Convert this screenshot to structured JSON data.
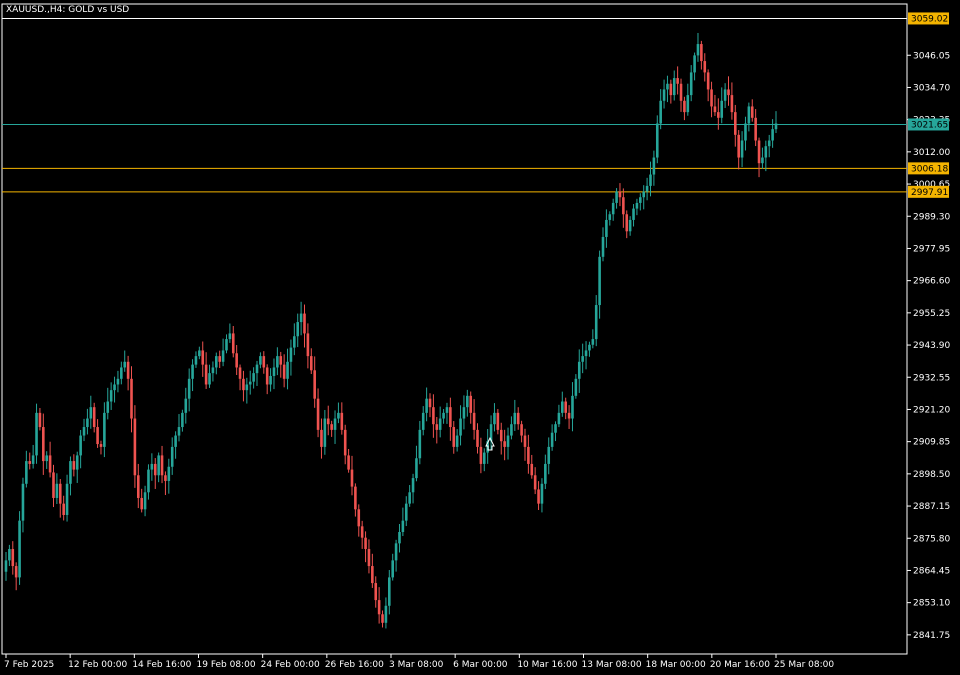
{
  "title": "XAUUSD.,H4:  GOLD vs USD",
  "colors": {
    "background": "#000000",
    "bull": "#26a69a",
    "bear": "#ef5350",
    "axis": "#ffffff",
    "bid_line": "#26a69a",
    "level_line": "#f4b400",
    "top_line": "#ffffff"
  },
  "price_axis": {
    "ticks": [
      "3046.05",
      "3034.70",
      "3023.35",
      "3012.00",
      "3000.65",
      "2989.30",
      "2977.95",
      "2966.60",
      "2955.25",
      "2943.90",
      "2932.55",
      "2921.20",
      "2909.85",
      "2898.50",
      "2887.15",
      "2875.80",
      "2864.45",
      "2853.10",
      "2841.75"
    ]
  },
  "time_axis": {
    "labels": [
      "7 Feb 2025",
      "12 Feb 00:00",
      "14 Feb 16:00",
      "19 Feb 08:00",
      "24 Feb 00:00",
      "26 Feb 16:00",
      "3 Mar 08:00",
      "6 Mar 00:00",
      "10 Mar 16:00",
      "13 Mar 08:00",
      "18 Mar 00:00",
      "20 Mar 16:00",
      "25 Mar 08:00"
    ]
  },
  "price_tags": [
    {
      "value": 3059.02,
      "label": "3059.02",
      "kind": "top"
    },
    {
      "value": 3021.65,
      "label": "3021.65",
      "kind": "bid"
    },
    {
      "value": 3006.18,
      "label": "3006.18",
      "kind": "level"
    },
    {
      "value": 2997.91,
      "label": "2997.91",
      "kind": "level"
    }
  ],
  "chart_data": {
    "type": "candlestick",
    "symbol": "XAUUSD.",
    "timeframe": "H4",
    "ylim": [
      2835.0,
      3062.0
    ],
    "x_start_label": "7 Feb 2025",
    "x_end_label": "25 Mar 08:00",
    "closes": [
      2868,
      2872,
      2866,
      2862,
      2882,
      2895,
      2903,
      2902,
      2905,
      2920,
      2915,
      2903,
      2905,
      2899,
      2890,
      2895,
      2888,
      2884,
      2895,
      2903,
      2900,
      2905,
      2912,
      2915,
      2918,
      2922,
      2915,
      2909,
      2908,
      2920,
      2924,
      2928,
      2930,
      2932,
      2936,
      2938,
      2932,
      2918,
      2898,
      2890,
      2886,
      2892,
      2900,
      2902,
      2898,
      2905,
      2898,
      2896,
      2901,
      2908,
      2912,
      2915,
      2920,
      2925,
      2932,
      2937,
      2940,
      2942,
      2937,
      2930,
      2934,
      2936,
      2940,
      2938,
      2942,
      2946,
      2948,
      2941,
      2936,
      2932,
      2928,
      2930,
      2931,
      2934,
      2937,
      2940,
      2936,
      2930,
      2933,
      2936,
      2940,
      2937,
      2932,
      2938,
      2943,
      2947,
      2952,
      2955,
      2948,
      2940,
      2935,
      2925,
      2914,
      2908,
      2918,
      2916,
      2914,
      2918,
      2920,
      2914,
      2905,
      2900,
      2894,
      2886,
      2880,
      2876,
      2872,
      2866,
      2860,
      2854,
      2849,
      2846,
      2852,
      2862,
      2868,
      2874,
      2878,
      2882,
      2888,
      2892,
      2897,
      2904,
      2914,
      2920,
      2925,
      2922,
      2916,
      2914,
      2918,
      2920,
      2922,
      2915,
      2908,
      2912,
      2918,
      2922,
      2926,
      2920,
      2914,
      2908,
      2902,
      2906,
      2910,
      2916,
      2920,
      2914,
      2910,
      2908,
      2912,
      2916,
      2920,
      2916,
      2912,
      2908,
      2902,
      2898,
      2893,
      2888,
      2895,
      2902,
      2908,
      2913,
      2916,
      2920,
      2924,
      2920,
      2918,
      2926,
      2932,
      2938,
      2940,
      2942,
      2944,
      2946,
      2958,
      2975,
      2982,
      2988,
      2990,
      2994,
      2998,
      2996,
      2990,
      2984,
      2988,
      2992,
      2994,
      2996,
      2998,
      3000,
      3004,
      3010,
      3022,
      3030,
      3034,
      3036,
      3032,
      3038,
      3036,
      3030,
      3026,
      3032,
      3040,
      3046,
      3050,
      3044,
      3040,
      3034,
      3028,
      3026,
      3024,
      3030,
      3034,
      3032,
      3026,
      3018,
      3010,
      3016,
      3022,
      3028,
      3024,
      3016,
      3008,
      3010,
      3014,
      3016,
      3020,
      3022
    ]
  }
}
